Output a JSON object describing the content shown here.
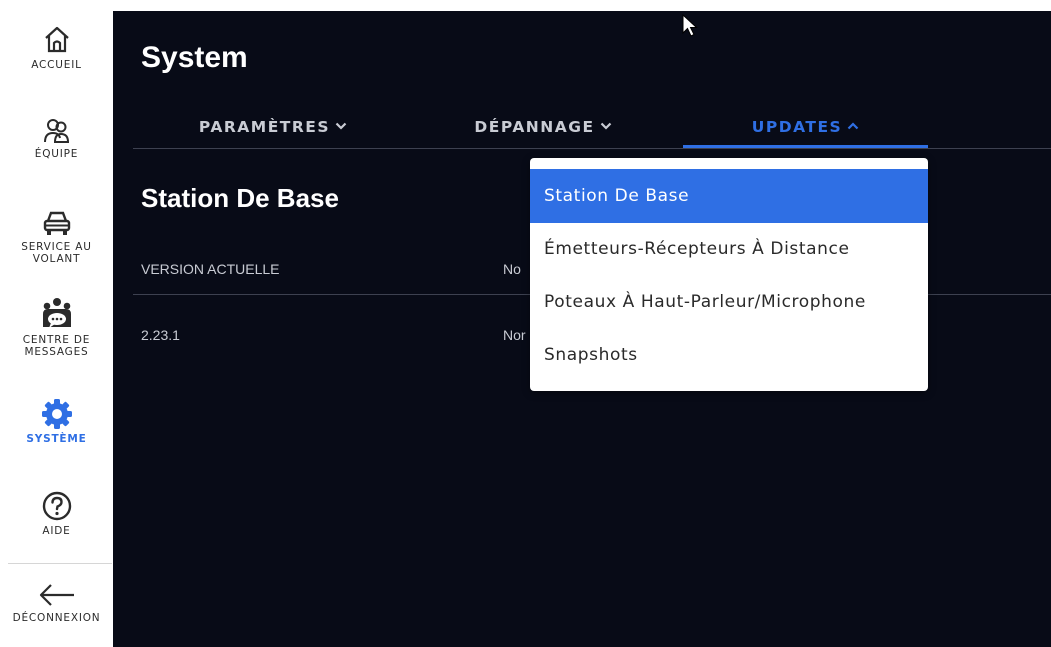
{
  "sidebar": {
    "items": [
      {
        "label": "ACCUEIL",
        "icon": "home-icon"
      },
      {
        "label": "ÉQUIPE",
        "icon": "team-icon"
      },
      {
        "label": "SERVICE AU VOLANT",
        "line1": "SERVICE AU",
        "line2": "VOLANT",
        "icon": "car-icon"
      },
      {
        "label": "CENTRE DE MESSAGES",
        "line1": "CENTRE DE",
        "line2": "MESSAGES",
        "icon": "message-center-icon"
      },
      {
        "label": "SYSTÈME",
        "icon": "gear-icon",
        "active": true
      },
      {
        "label": "AIDE",
        "icon": "help-icon"
      },
      {
        "label": "DÉCONNEXION",
        "icon": "arrow-left-icon"
      }
    ]
  },
  "header": {
    "title": "System"
  },
  "tabs": [
    {
      "label": "PARAMÈTRES",
      "expanded": false
    },
    {
      "label": "DÉPANNAGE",
      "expanded": false
    },
    {
      "label": "UPDATES",
      "expanded": true,
      "active": true
    }
  ],
  "section": {
    "title": "Station De Base",
    "columns": [
      "VERSION ACTUELLE",
      "No"
    ],
    "row": [
      "2.23.1",
      "Nor"
    ]
  },
  "dropdown": {
    "items": [
      {
        "label": "Station De Base",
        "selected": true
      },
      {
        "label": "Émetteurs-Récepteurs À Distance"
      },
      {
        "label": "Poteaux À Haut-Parleur/Microphone"
      },
      {
        "label": "Snapshots"
      }
    ]
  },
  "colors": {
    "accent": "#2f6fe4",
    "panel_bg": "#080b17",
    "sidebar_bg": "#ffffff"
  }
}
